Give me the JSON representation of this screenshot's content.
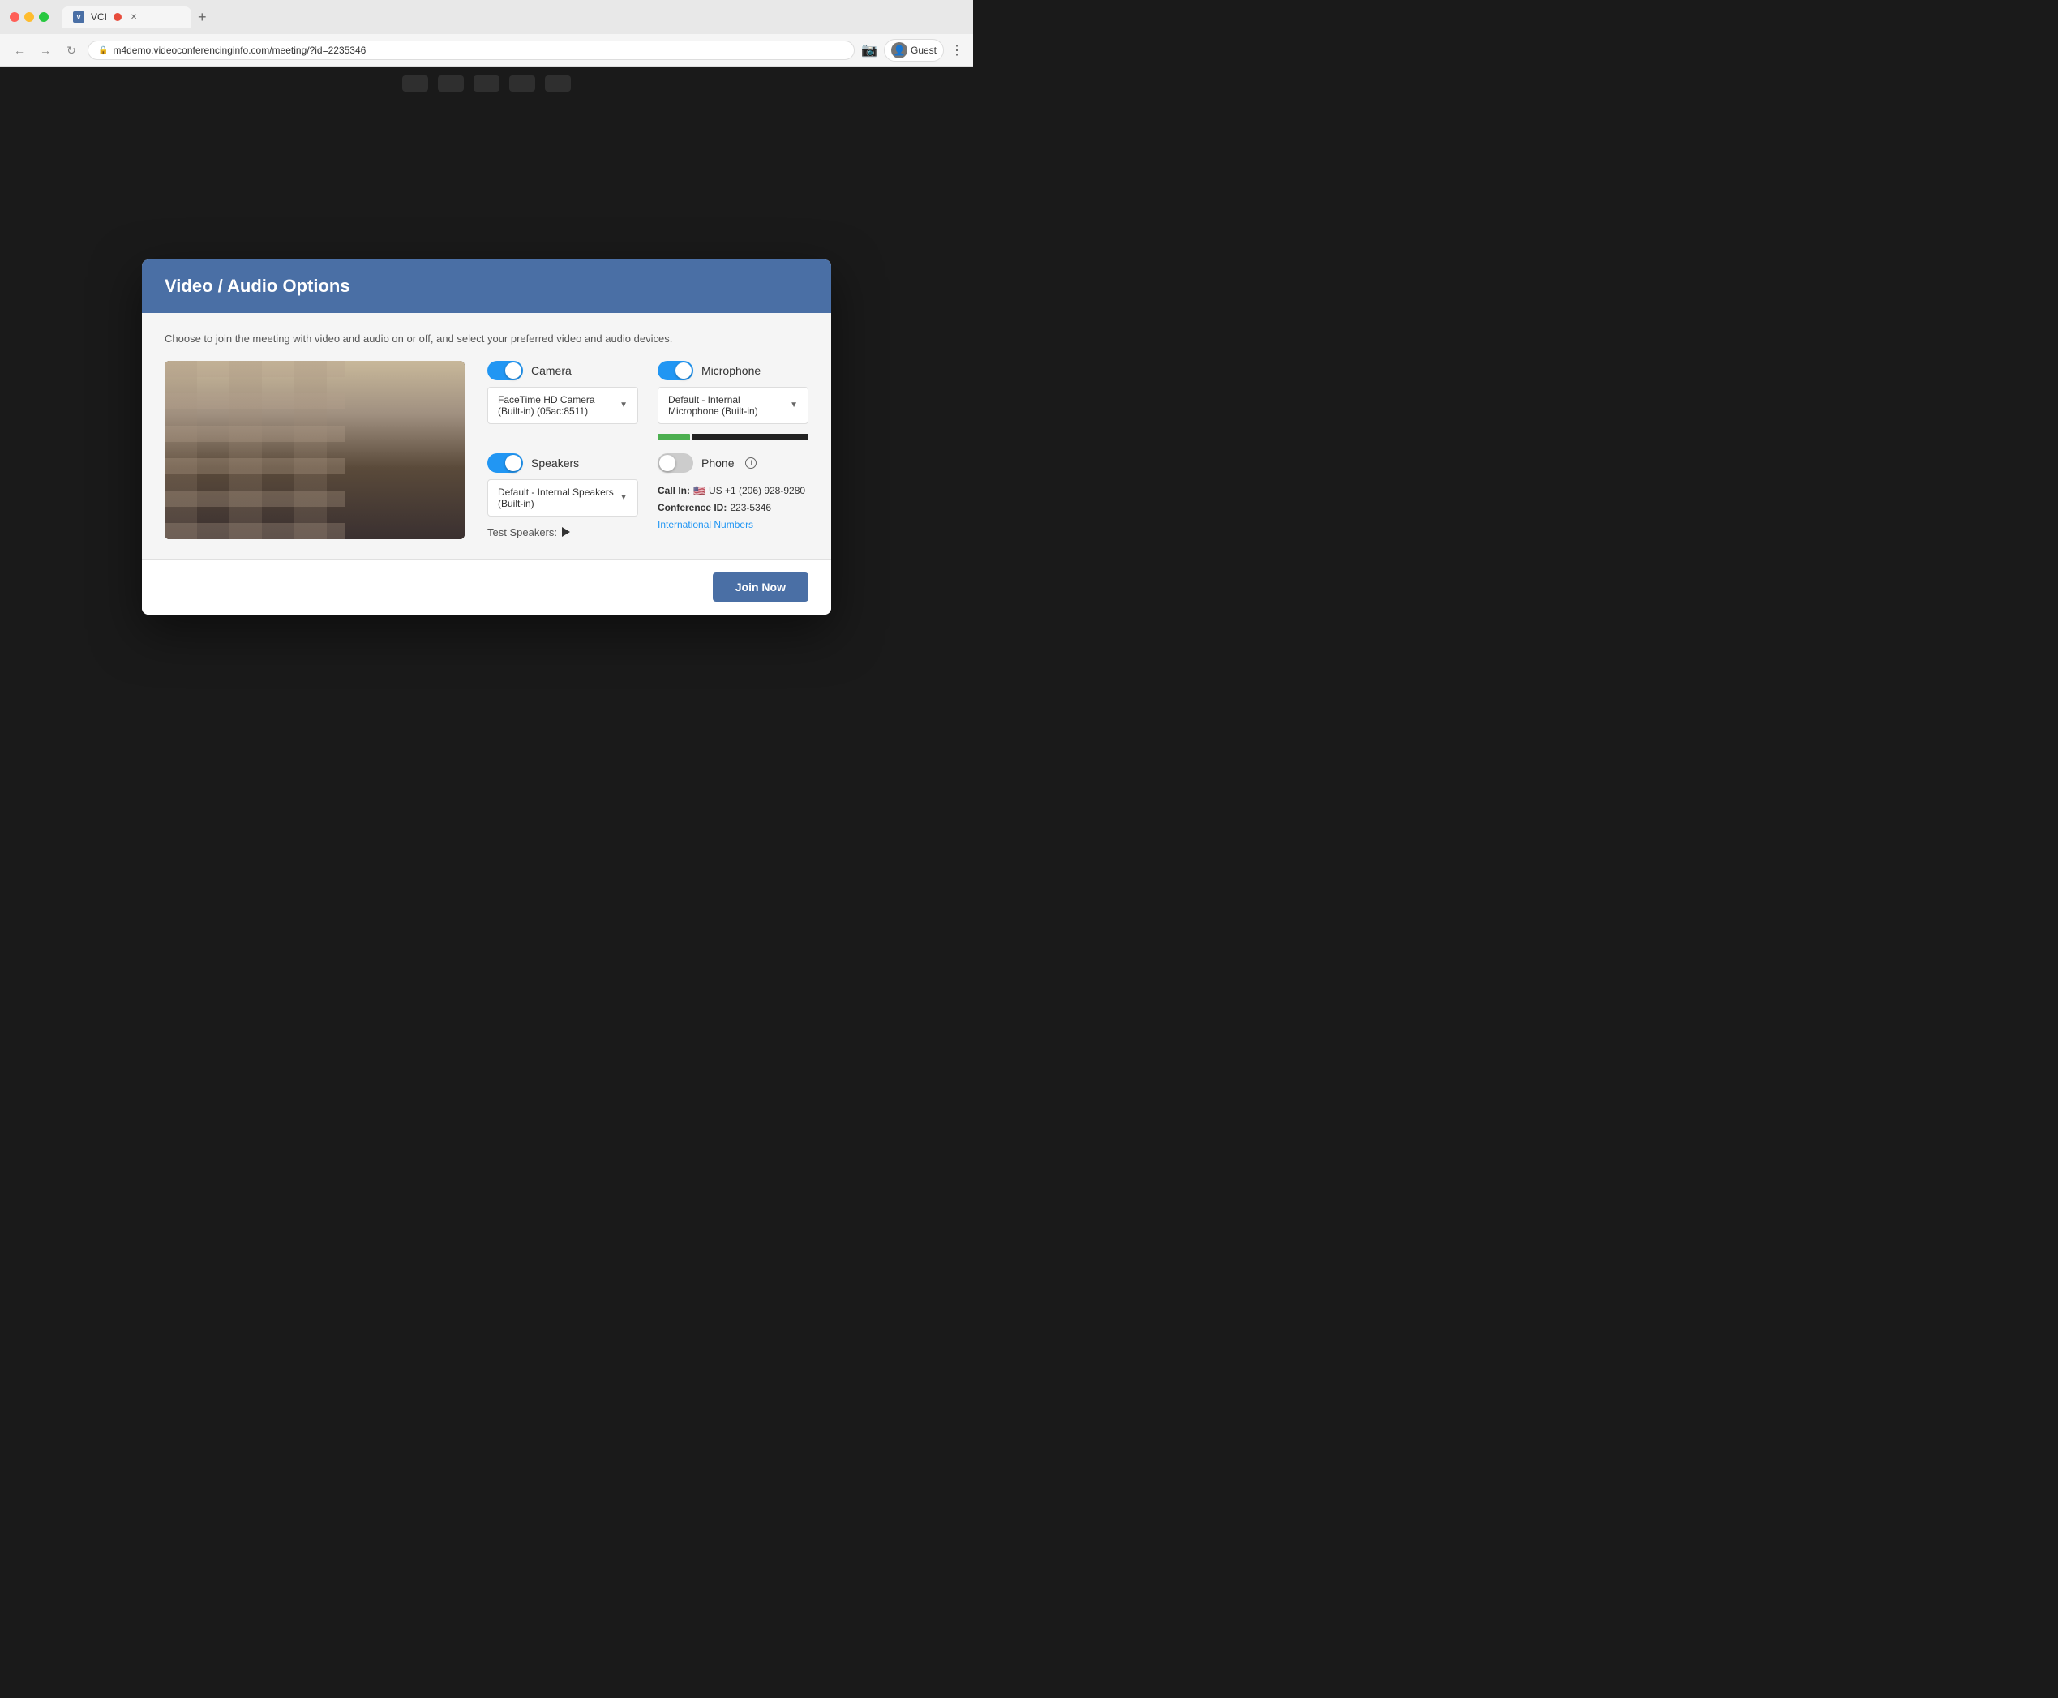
{
  "browser": {
    "tab_favicon": "V",
    "tab_title": "VCI",
    "tab_record_indicator": true,
    "url": "m4demo.videoconferencing info.com/meeting/?id=2235346",
    "url_display": "m4demo.videoconferencinginfo.com/meeting/?id=2235346",
    "account_label": "Guest",
    "new_tab_icon": "+"
  },
  "modal": {
    "title": "Video / Audio Options",
    "description": "Choose to join the meeting with video and audio on or off, and select your preferred video and audio devices.",
    "camera": {
      "label": "Camera",
      "enabled": true,
      "device": "FaceTime HD Camera (Built-in) (05ac:8511)"
    },
    "microphone": {
      "label": "Microphone",
      "enabled": true,
      "device": "Default - Internal Microphone (Built-in)"
    },
    "speakers": {
      "label": "Speakers",
      "enabled": true,
      "device": "Default - Internal Speakers (Built-in)"
    },
    "phone": {
      "label": "Phone",
      "enabled": false,
      "call_in_label": "Call In:",
      "flag": "🇺🇸",
      "number": "US +1 (206) 928-9280",
      "conference_id_label": "Conference ID:",
      "conference_id": "223-5346",
      "international_link": "International Numbers"
    },
    "test_speakers_label": "Test Speakers:",
    "join_now_label": "Join Now"
  }
}
